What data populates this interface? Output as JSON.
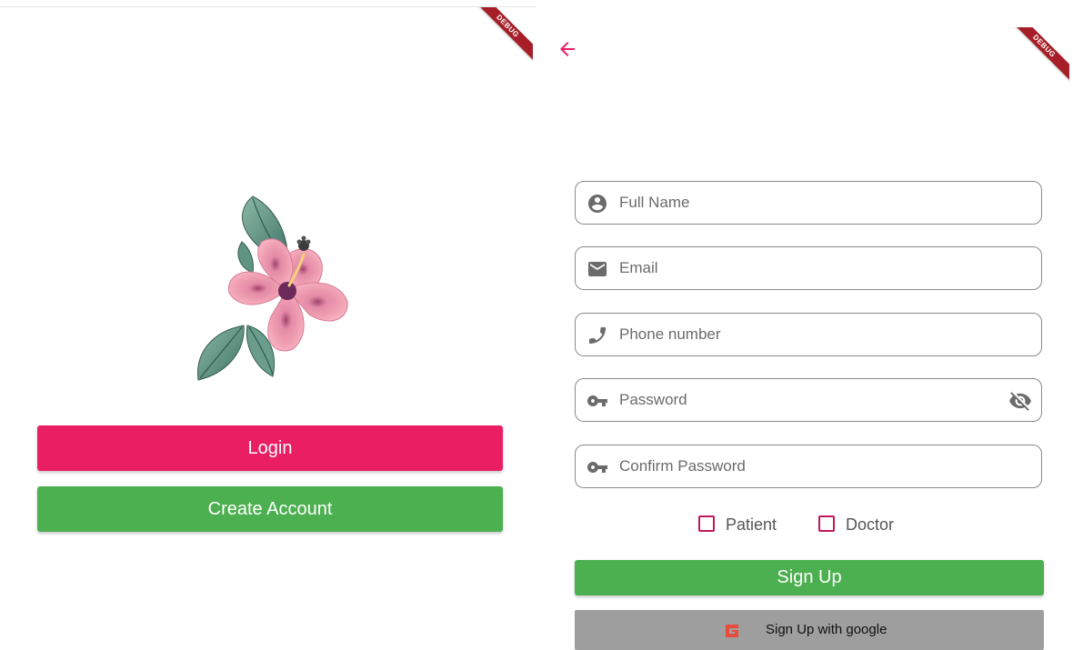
{
  "debug_banner": {
    "label": "DEBUG",
    "color": "#a61e27"
  },
  "welcome": {
    "login_label": "Login",
    "create_account_label": "Create Account",
    "colors": {
      "login": "#e91e63",
      "create_account": "#4caf50"
    },
    "illustration": "hibiscus-flower"
  },
  "signup": {
    "back_icon": "arrow-left-icon",
    "fields": {
      "full_name": {
        "placeholder": "Full Name",
        "icon": "account-circle-icon"
      },
      "email": {
        "placeholder": "Email",
        "icon": "mail-icon"
      },
      "phone": {
        "placeholder": "Phone number",
        "icon": "phone-icon"
      },
      "password": {
        "placeholder": "Password",
        "icon": "key-icon",
        "trailing_icon": "visibility-off-icon"
      },
      "confirm_password": {
        "placeholder": "Confirm Password",
        "icon": "key-icon"
      }
    },
    "roles": [
      {
        "label": "Patient",
        "checked": false
      },
      {
        "label": "Doctor",
        "checked": false
      }
    ],
    "sign_up_label": "Sign Up",
    "google_label": "Sign Up with google",
    "colors": {
      "accent": "#e91e63",
      "sign_up": "#4caf50",
      "google_button": "#9e9e9e",
      "google_icon": "#e74c3c"
    }
  }
}
